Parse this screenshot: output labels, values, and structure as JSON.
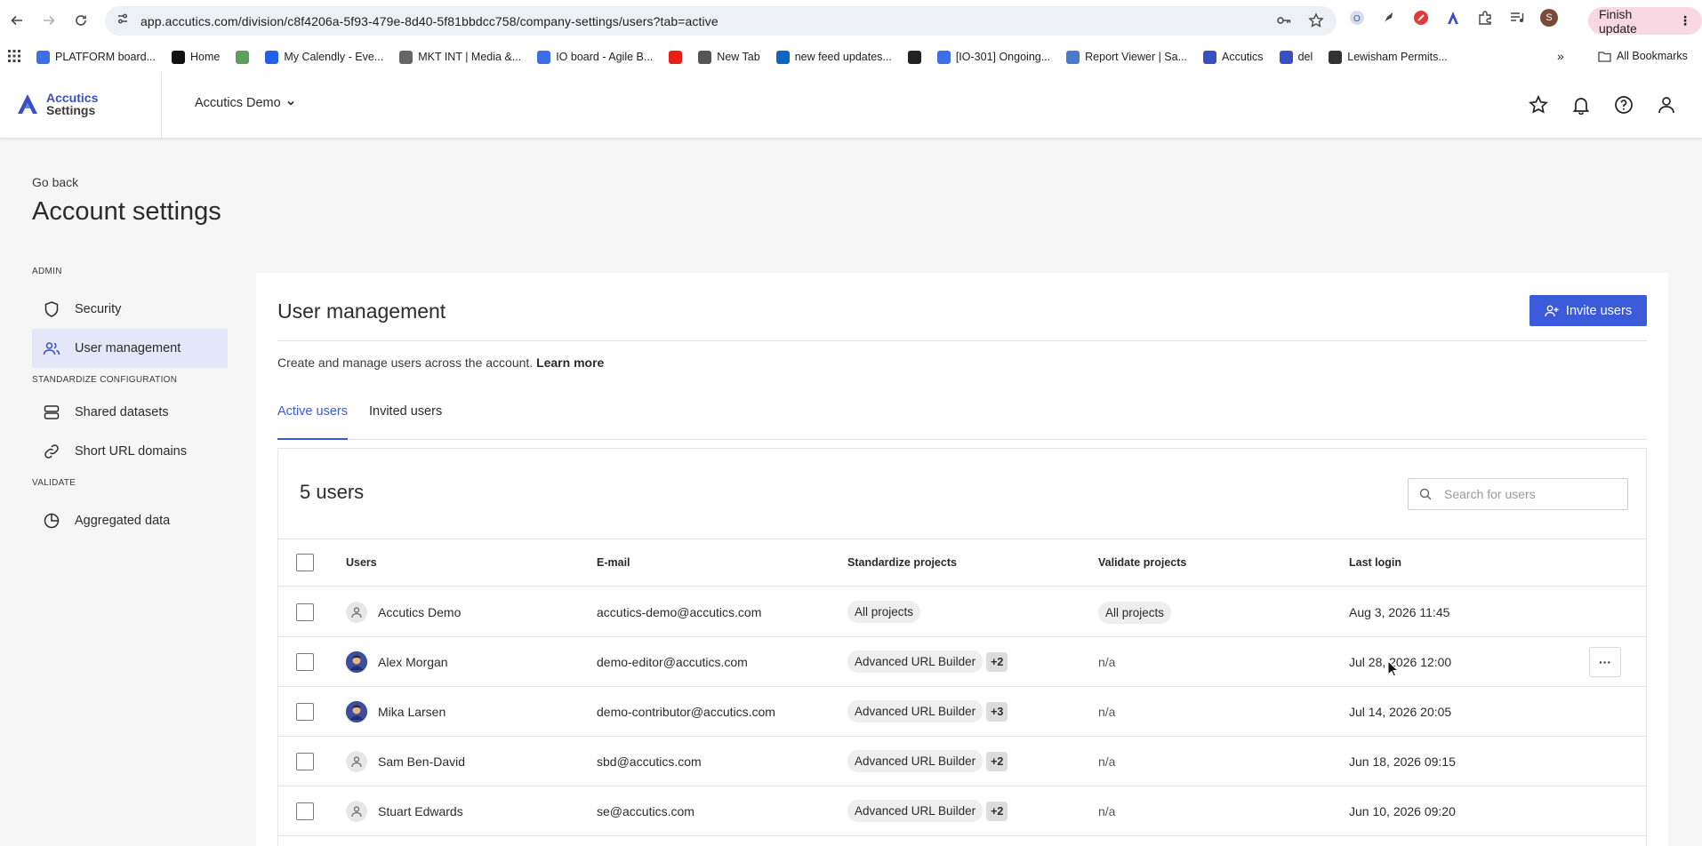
{
  "browser": {
    "url": "app.accutics.com/division/c8f4206a-5f93-479e-8d40-5f81bbdcc758/company-settings/users?tab=active",
    "finish_update_label": "Finish update",
    "profile_initial": "S",
    "bookmarks": [
      {
        "label": "PLATFORM board...",
        "icon": "jira-icon",
        "color": "#3c6ee8"
      },
      {
        "label": "Home",
        "icon": "x-icon",
        "color": "#111111"
      },
      {
        "label": "",
        "icon": "accutics-icon",
        "color": "#5aa05a"
      },
      {
        "label": "My Calendly - Eve...",
        "icon": "calendly-icon",
        "color": "#2360e8"
      },
      {
        "label": "MKT INT | Media &...",
        "icon": "doc-icon",
        "color": "#666666"
      },
      {
        "label": "IO board - Agile B...",
        "icon": "jira-icon",
        "color": "#3c6ee8"
      },
      {
        "label": "",
        "icon": "youtube-icon",
        "color": "#e62117"
      },
      {
        "label": "New Tab",
        "icon": "chrome-icon",
        "color": "#555555"
      },
      {
        "label": "new feed updates...",
        "icon": "linkedin-icon",
        "color": "#0a66c2"
      },
      {
        "label": "",
        "icon": "globe-icon",
        "color": "#222222"
      },
      {
        "label": "[IO-301] Ongoing...",
        "icon": "jira-icon",
        "color": "#3c6ee8"
      },
      {
        "label": "Report Viewer | Sa...",
        "icon": "cloud-icon",
        "color": "#4a7bd0"
      },
      {
        "label": "Accutics",
        "icon": "accutics-icon",
        "color": "#3b4fc4"
      },
      {
        "label": "del",
        "icon": "accutics-icon",
        "color": "#3b4fc4"
      },
      {
        "label": "Lewisham Permits...",
        "icon": "lewisham-icon",
        "color": "#333333"
      }
    ],
    "all_bookmarks_label": "All Bookmarks"
  },
  "app": {
    "logo_line1": "Accutics",
    "logo_line2": "Settings",
    "company": "Accutics Demo"
  },
  "page": {
    "go_back": "Go back",
    "title": "Account settings"
  },
  "sidebar": {
    "sections": [
      {
        "title": "ADMIN",
        "items": [
          {
            "label": "Security",
            "icon": "shield-icon",
            "active": false
          },
          {
            "label": "User management",
            "icon": "users-icon",
            "active": true
          }
        ]
      },
      {
        "title": "STANDARDIZE CONFIGURATION",
        "items": [
          {
            "label": "Shared datasets",
            "icon": "database-icon",
            "active": false
          },
          {
            "label": "Short URL domains",
            "icon": "link-icon",
            "active": false
          }
        ]
      },
      {
        "title": "VALIDATE",
        "items": [
          {
            "label": "Aggregated data",
            "icon": "pie-chart-icon",
            "active": false
          }
        ]
      }
    ]
  },
  "main": {
    "title": "User management",
    "invite_label": "Invite users",
    "description": "Create and manage users across the account.",
    "learn_more": "Learn more",
    "tabs": [
      {
        "label": "Active users",
        "active": true
      },
      {
        "label": "Invited users",
        "active": false
      }
    ],
    "user_count": "5 users",
    "search_placeholder": "Search for users",
    "columns": [
      "Users",
      "E-mail",
      "Standardize projects",
      "Validate projects",
      "Last login"
    ],
    "rows": [
      {
        "name": "Accutics Demo",
        "email": "accutics-demo@accutics.com",
        "std": "All projects",
        "std_more": "",
        "val": "All projects",
        "login": "Aug 3, 2026 11:45",
        "avatar": "default"
      },
      {
        "name": "Alex Morgan",
        "email": "demo-editor@accutics.com",
        "std": "Advanced URL Builder",
        "std_more": "+2",
        "val": "n/a",
        "login": "Jul 28, 2026 12:00",
        "avatar": "photo"
      },
      {
        "name": "Mika Larsen",
        "email": "demo-contributor@accutics.com",
        "std": "Advanced URL Builder",
        "std_more": "+3",
        "val": "n/a",
        "login": "Jul 14, 2026 20:05",
        "avatar": "photo"
      },
      {
        "name": "Sam Ben-David",
        "email": "sbd@accutics.com",
        "std": "Advanced URL Builder",
        "std_more": "+2",
        "val": "n/a",
        "login": "Jun 18, 2026 09:15",
        "avatar": "default"
      },
      {
        "name": "Stuart Edwards",
        "email": "se@accutics.com",
        "std": "Advanced URL Builder",
        "std_more": "+2",
        "val": "n/a",
        "login": "Jun 10, 2026 09:20",
        "avatar": "default"
      }
    ],
    "row_menu_label": "···"
  }
}
